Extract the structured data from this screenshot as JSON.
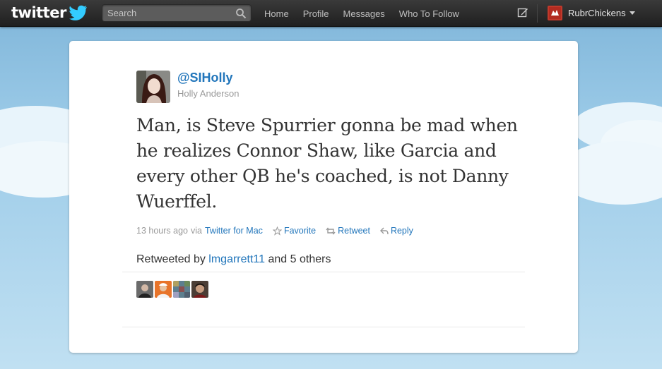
{
  "topbar": {
    "logo_text": "twitter",
    "search_placeholder": "Search",
    "nav": [
      "Home",
      "Profile",
      "Messages",
      "Who To Follow"
    ],
    "account_name": "RubrChickens"
  },
  "tweet": {
    "handle": "@SIHolly",
    "full_name": "Holly Anderson",
    "text": "Man, is Steve Spurrier gonna be mad when he realizes Connor Shaw, like Garcia and every other QB he's coached, is not Danny Wuerffel.",
    "time": "13 hours ago",
    "via_prefix": "via",
    "via_client": "Twitter for Mac",
    "favorite_label": "Favorite",
    "retweet_label": "Retweet",
    "reply_label": "Reply",
    "retweeted_prefix": "Retweeted by",
    "retweeted_user": "lmgarrett11",
    "retweeted_suffix": "and 5 others"
  },
  "colors": {
    "link": "#2276bb",
    "topbar": "#2b2b2b",
    "background_sky": "#9ccbe8"
  },
  "icons": [
    "twitter-bird-icon",
    "search-icon",
    "compose-icon",
    "star-icon",
    "retweet-icon",
    "reply-icon",
    "chevron-down-icon"
  ]
}
